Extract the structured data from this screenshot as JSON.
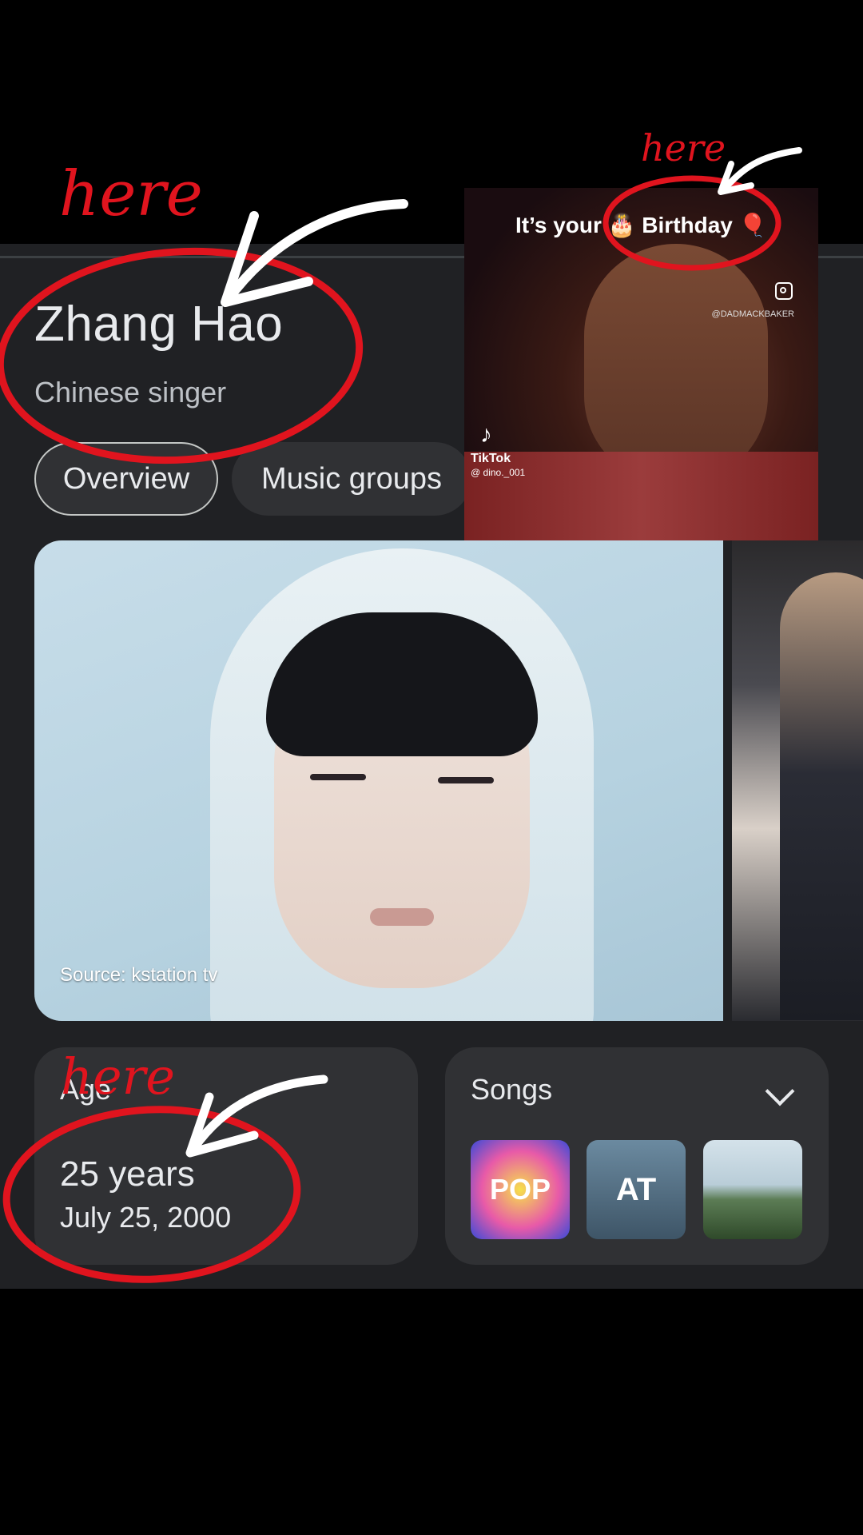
{
  "knowledge_panel": {
    "title": "Zhang Hao",
    "subtitle": "Chinese singer",
    "tabs": [
      {
        "label": "Overview",
        "active": true
      },
      {
        "label": "Music groups",
        "active": false
      }
    ],
    "hero_image": {
      "source_label": "Source: kstation tv"
    },
    "age_card": {
      "label": "Age",
      "value": "25 years",
      "date": "July 25, 2000"
    },
    "songs_card": {
      "label": "Songs",
      "thumbnail_texts": [
        "POP",
        "AT"
      ]
    }
  },
  "tiktok_overlay": {
    "caption": "It’s your 🎂 Birthday 🎈",
    "handle": "@DADMACKBAKER",
    "brand": "TikTok",
    "user": "@ dino._001"
  },
  "annotations": {
    "word": "here",
    "color": "#e0141e",
    "arrow_color": "#ffffff"
  }
}
